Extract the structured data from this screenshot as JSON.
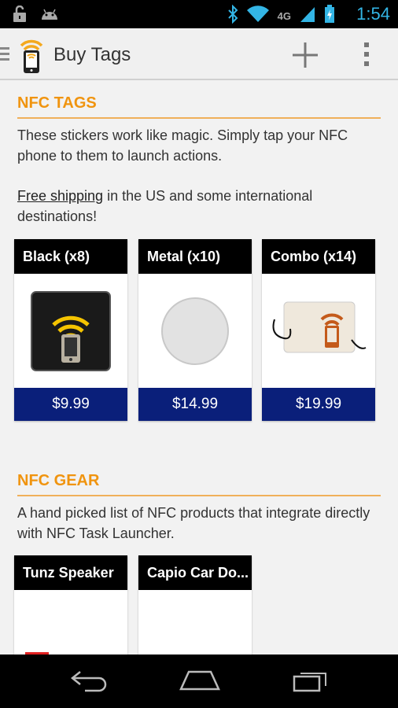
{
  "status_bar": {
    "time": "1:54",
    "network": "4G",
    "icons": [
      "unlock-icon",
      "android-icon",
      "bluetooth-icon",
      "wifi-icon",
      "signal-icon",
      "battery-charging-icon"
    ]
  },
  "action_bar": {
    "title": "Buy Tags",
    "icons": [
      "up-icon",
      "app-logo-icon",
      "add-icon",
      "overflow-menu-icon"
    ]
  },
  "nfc_tags": {
    "header": "NFC TAGS",
    "description": "These stickers work like magic. Simply tap your NFC phone to them to launch actions.",
    "shipping_link": "Free shipping",
    "shipping_rest": " in the US and some international destinations!",
    "products": [
      {
        "title": "Black (x8)",
        "price": "$9.99",
        "image": "black-nfc-sticker-image"
      },
      {
        "title": "Metal (x10)",
        "price": "$14.99",
        "image": "metal-nfc-sticker-image"
      },
      {
        "title": "Combo (x14)",
        "price": "$19.99",
        "image": "combo-nfc-tag-image"
      }
    ]
  },
  "nfc_gear": {
    "header": "NFC GEAR",
    "description": "A hand picked list of NFC products that integrate directly with NFC Task Launcher.",
    "products": [
      {
        "title": "Tunz Speaker",
        "image": "speaker-image"
      },
      {
        "title": "Capio Car Do...",
        "image": "car-dock-image"
      }
    ]
  },
  "nav_bar": {
    "icons": [
      "back-icon",
      "home-icon",
      "recent-apps-icon"
    ]
  },
  "colors": {
    "accent": "#f0940f",
    "price_bg": "#0a1f7a",
    "status_blue": "#33b5e5"
  }
}
